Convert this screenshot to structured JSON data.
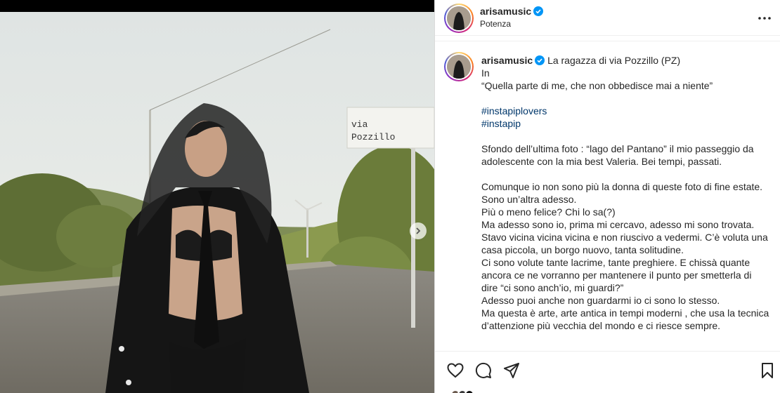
{
  "post": {
    "username": "arisamusic",
    "location": "Potenza",
    "caption_intro": "La ragazza di via Pozzillo (PZ)",
    "caption_lines_1": "In\n“Quella parte di me, che non obbedisce mai a niente”\n",
    "hashtags": [
      "#instapiplovers",
      "#instapip"
    ],
    "caption_lines_2": "\nSfondo dell’ultima foto : “lago del Pantano” il mio passeggio da adolescente con la mia best Valeria. Bei tempi, passati.\n\nComunque io non sono più la donna di queste foto di fine estate. Sono un’altra adesso.\nPiù o meno felice? Chi lo sa(?)\nMa adesso sono io, prima mi cercavo, adesso mi sono trovata. Stavo vicina vicina vicina e non riuscivo a vedermi. C’è voluta una casa piccola, un borgo nuovo, tanta solitudine.\nCi sono volute tante lacrime, tante preghiere. E chissà quante ancora ce ne vorranno per mantenere il punto per smetterla di dire “ci sono anch’io, mi guardi?”\nAdesso puoi anche non guardarmi io ci sono lo stesso.\nMa questa è arte, arte antica in tempi moderni , che usa la tecnica d’attenzione più vecchia del mondo e ci riesce sempre."
  },
  "photo": {
    "sign_line1": "via",
    "sign_line2": "Pozzillo"
  },
  "icons": {
    "verified": "verified-badge-icon",
    "more": "more-options-icon",
    "like": "heart-icon",
    "comment": "comment-icon",
    "share": "share-icon",
    "save": "bookmark-icon",
    "next": "chevron-right-icon"
  },
  "colors": {
    "verified": "#0095f6",
    "hashtag": "#00376b",
    "text": "#262626"
  }
}
